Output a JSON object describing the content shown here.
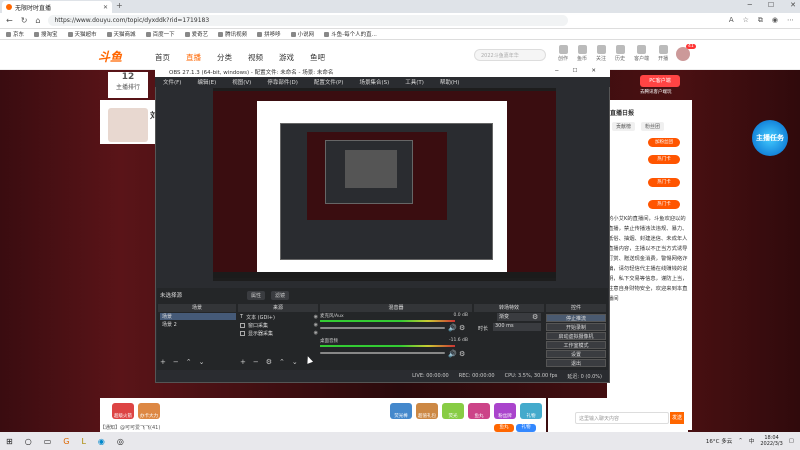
{
  "browser": {
    "tab_title": "无限时时直播",
    "url": "https://www.douyu.com/topic/dyxddk?rid=1719183",
    "favorites": [
      "京东",
      "搜淘宝",
      "天猫超市",
      "天猫商城",
      "百度一下",
      "爱奇艺",
      "腾讯视频",
      "拼哆哆",
      "小说网",
      "斗鱼-每个人的直..."
    ]
  },
  "site": {
    "logo": "斗鱼",
    "nav": [
      "首页",
      "直播",
      "分类",
      "视频",
      "游戏",
      "鱼吧"
    ],
    "search_placeholder": "2022斗鱼嘉年华",
    "header_icons": [
      "创作",
      "鱼币",
      "关注",
      "历史",
      "客户端",
      "开播"
    ],
    "avatar_badge": "41",
    "rank_num": "12",
    "rank_label": "主播排行",
    "streamer_name": "刘",
    "right_header": "直播日报",
    "right_tabs": [
      "贡献榜",
      "粉丝团"
    ],
    "right_top_btn": "PC客户端",
    "right_top_text": "去腾讯客户端玩",
    "right_buttons": [
      "加粉丝团",
      "热门卡",
      "热门卡",
      "热门卡"
    ],
    "description": "的小艾K的直播间，斗鱼欢迎以的直播，禁止传播违法违规、暴力、低俗、抽烟、封建迷信、未成年人直播内容，主播以不正当方式诱导打赏、赠送现金消费，警惕网络诈骗，请勿轻信代主播在线赚钱的说明，私下交易等信息，谨防上当，注意自身财物安全，欢迎来到本直播间",
    "promo": "主播任务",
    "gifts": [
      "超级火箭",
      "办卡大力",
      "荧光棒",
      "超值礼包",
      "荧光",
      "鱼丸",
      "粉丝牌",
      "礼物"
    ],
    "gift_btn_a": "鱼丸",
    "gift_btn_b": "礼物",
    "chat_placeholder": "这里输入聊天内容",
    "chat_send": "发送",
    "notice": "【通知】@可可爱飞飞(41)"
  },
  "obs": {
    "title": "OBS 27.1.3 (64-bit, windows) - 配置文件: 未命名 - 场景: 未命名",
    "menu": [
      "文件(F)",
      "编辑(E)",
      "视图(V)",
      "停靠部件(D)",
      "配置文件(P)",
      "场景集合(S)",
      "工具(T)",
      "帮助(H)"
    ],
    "no_source": "未选择源",
    "filter_btns": [
      "属性",
      "滤镜"
    ],
    "docks": [
      "场景",
      "来源",
      "混音器",
      "转场特效",
      "控件"
    ],
    "scenes": [
      "场景",
      "场景 2"
    ],
    "sources": [
      "文本 (GDI+)",
      "窗口采集",
      "显示器采集"
    ],
    "mixer": [
      {
        "name": "麦克风/Aux",
        "db": "0.0 dB"
      },
      {
        "name": "桌面音频",
        "db": "-11.6 dB"
      }
    ],
    "transition_label": "渐变",
    "duration_label": "时长",
    "duration_value": "300 ms",
    "controls": [
      "停止推流",
      "开始录制",
      "启动虚拟摄像机",
      "工作室模式",
      "设置",
      "退出"
    ],
    "status": [
      "LIVE: 00:00:00",
      "REC: 00:00:00",
      "CPU: 3.5%, 30.00 fps",
      "延迟: 0 (0.0%)"
    ]
  },
  "taskbar": {
    "weather": "16°C 多云",
    "ime": "中",
    "time": "18:04",
    "date": "2022/3/3"
  }
}
